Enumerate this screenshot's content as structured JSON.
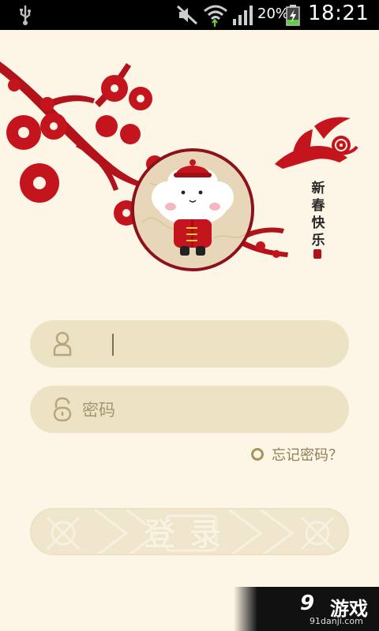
{
  "status_bar": {
    "battery_percent": "20%",
    "time": "18:21",
    "icons": [
      "usb-icon",
      "mute-icon",
      "wifi-icon",
      "signal-icon",
      "battery-charging-icon"
    ]
  },
  "banner": {
    "greeting_chars": [
      "新",
      "春",
      "快",
      "乐"
    ]
  },
  "login_form": {
    "username_placeholder": "",
    "password_placeholder": "密码",
    "forgot_password_label": "忘记密码？",
    "login_button_label": "登录"
  },
  "watermark": {
    "logo_num": "9",
    "logo_text": "游戏",
    "url": "91danji.com"
  },
  "colors": {
    "background": "#fdf5e6",
    "field": "#ece3c4",
    "accent_red": "#b2121a",
    "text_muted": "#927e55"
  }
}
